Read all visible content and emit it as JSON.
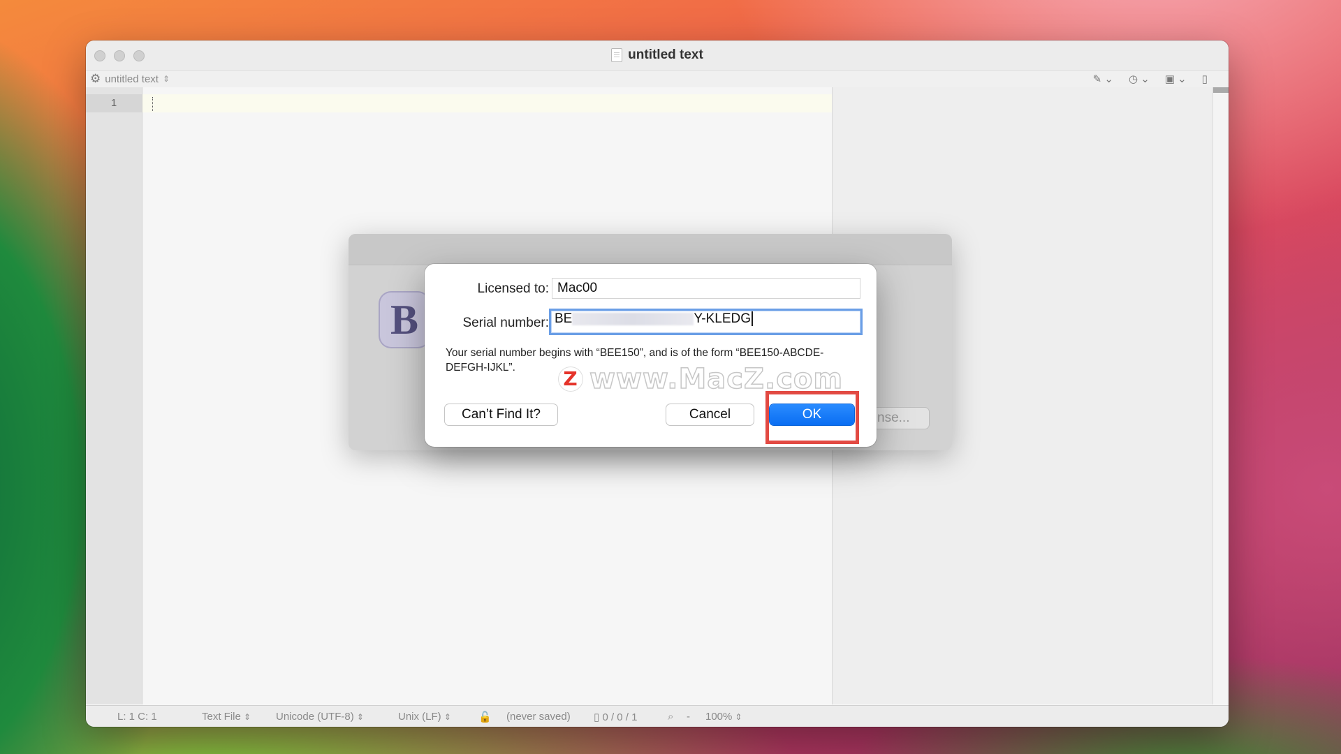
{
  "window": {
    "title": "untitled text",
    "nav_doc_name": "untitled text",
    "line_number": "1"
  },
  "status": {
    "position": "L: 1 C: 1",
    "file_type": "Text File",
    "encoding": "Unicode (UTF-8)",
    "line_endings": "Unix (LF)",
    "saved": "(never saved)",
    "counts": "0 / 0 / 1",
    "zoom_minus": "-",
    "zoom": "100%"
  },
  "back_panel": {
    "logo_letter": "B",
    "button_partial": "nse..."
  },
  "dialog": {
    "licensed_label": "Licensed to:",
    "licensed_value": "Mac00",
    "serial_label": "Serial number:",
    "serial_prefix": "BE",
    "serial_suffix": "Y-KLEDG",
    "hint": "Your serial number begins with “BEE150”, and is of the form “BEE150-ABCDE-DEFGH-IJKL”.",
    "cant_find_label": "Can’t Find It?",
    "cancel_label": "Cancel",
    "ok_label": "OK"
  },
  "watermark": {
    "logo": "Z",
    "text": "www.MacZ.com"
  },
  "icons": [
    "gear-icon",
    "pin-icon",
    "clock-icon",
    "windows-icon",
    "doc-icon",
    "lock-icon",
    "magnifier-icon"
  ],
  "colors": {
    "ok_button": "#0a6ef2",
    "highlight": "#e24a43",
    "focus_ring": "#6a9ee6"
  }
}
